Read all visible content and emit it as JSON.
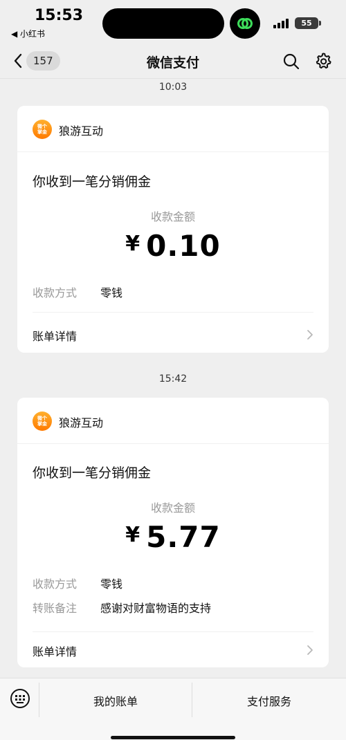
{
  "status_bar": {
    "time": "15:53",
    "back_app": "◀ 小红书",
    "battery": "55"
  },
  "nav": {
    "unread_count": "157",
    "title": "微信支付"
  },
  "messages": [
    {
      "timestamp": "10:03",
      "merchant_name": "狼游互动",
      "merchant_logo_text": "微个掌金",
      "heading": "你收到一笔分销佣金",
      "amount_label": "收款金额",
      "currency": "¥",
      "amount": "0.10",
      "rows": [
        {
          "label": "收款方式",
          "value": "零钱"
        }
      ],
      "detail_label": "账单详情"
    },
    {
      "timestamp": "15:42",
      "merchant_name": "狼游互动",
      "merchant_logo_text": "微个掌金",
      "heading": "你收到一笔分销佣金",
      "amount_label": "收款金额",
      "currency": "¥",
      "amount": "5.77",
      "rows": [
        {
          "label": "收款方式",
          "value": "零钱"
        },
        {
          "label": "转账备注",
          "value": "感谢对财富物语的支持"
        }
      ],
      "detail_label": "账单详情"
    }
  ],
  "bottom_bar": {
    "my_bills": "我的账单",
    "pay_services": "支付服务"
  },
  "colors": {
    "background": "#efefef",
    "card": "#ffffff",
    "muted_text": "#999999",
    "logo_orange": "#ff8a00",
    "island_badge_green": "#3ddc5a"
  }
}
